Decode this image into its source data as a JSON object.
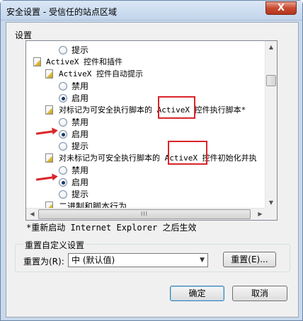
{
  "window": {
    "title": "安全设置 - 受信任的站点区域",
    "close_glyph": "X"
  },
  "settings_label": "设置",
  "list": {
    "rows": [
      {
        "kind": "radio",
        "label": "提示",
        "checked": false
      },
      {
        "kind": "category",
        "label": "ActiveX 控件和插件"
      },
      {
        "kind": "setting",
        "label": "ActiveX 控件自动提示"
      },
      {
        "kind": "radio",
        "label": "禁用",
        "checked": false
      },
      {
        "kind": "radio",
        "label": "启用",
        "checked": true
      },
      {
        "kind": "setting",
        "label": "对标记为可安全执行脚本的 ActiveX 控件执行脚本*"
      },
      {
        "kind": "radio",
        "label": "禁用",
        "checked": false
      },
      {
        "kind": "radio",
        "label": "启用",
        "checked": true
      },
      {
        "kind": "radio",
        "label": "提示",
        "checked": false
      },
      {
        "kind": "setting",
        "label": "对未标记为可安全执行脚本的 ActiveX 控件初始化并执"
      },
      {
        "kind": "radio",
        "label": "禁用",
        "checked": false
      },
      {
        "kind": "radio",
        "label": "启用",
        "checked": true
      },
      {
        "kind": "radio",
        "label": "提示",
        "checked": false
      },
      {
        "kind": "setting",
        "label": "二进制和脚本行为"
      }
    ],
    "hscroll_grip": "III"
  },
  "note": "*重新启动 Internet Explorer 之后生效",
  "reset_group": {
    "title": "重置自定义设置",
    "reset_to_label": "重置为(R):",
    "select_value": "中 (默认值)",
    "reset_button": "重置(E)..."
  },
  "buttons": {
    "ok": "确定",
    "cancel": "取消"
  },
  "colors": {
    "highlight": "#d9252a",
    "title_bg": "#c9d9ec",
    "close_btn": "#c74a30"
  }
}
